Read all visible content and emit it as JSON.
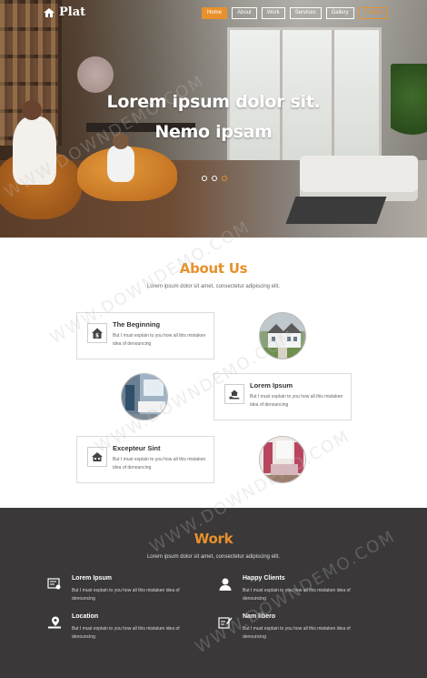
{
  "brand": {
    "name": "Plat"
  },
  "nav": {
    "items": [
      {
        "label": "Home",
        "state": "active"
      },
      {
        "label": "About",
        "state": ""
      },
      {
        "label": "Work",
        "state": ""
      },
      {
        "label": "Services",
        "state": ""
      },
      {
        "label": "Gallery",
        "state": ""
      },
      {
        "label": "Contact",
        "state": "contact"
      }
    ]
  },
  "hero": {
    "title_line1": "Lorem ipsum dolor sit.",
    "title_line2": "Nemo ipsam",
    "slider": {
      "count": 3,
      "active_index": 2
    }
  },
  "about": {
    "title": "About Us",
    "subtitle": "Lorem ipsum dolor sit amet, consectetur adipiscing elit.",
    "cards": [
      {
        "title": "The Beginning",
        "text": "But I must explain to you how all this mistaken idea of denouncing",
        "icon": "house-dollar-icon"
      },
      {
        "title": "Lorem Ipsum",
        "text": "But I must explain to you how all this mistaken idea of denouncing",
        "icon": "house-hand-icon"
      },
      {
        "title": "Excepteur Sint",
        "text": "But I must explain to you how all this mistaken idea of denouncing",
        "icon": "house-icon"
      }
    ],
    "photos": [
      "house-exterior-photo",
      "bathroom-photo",
      "bedroom-photo"
    ]
  },
  "work": {
    "title": "Work",
    "subtitle": "Lorem ipsum dolor sit amet, consectetur adipiscing elit.",
    "items": [
      {
        "title": "Lorem Ipsum",
        "text": "But I must explain to you how all this mistaken idea of denouncing",
        "icon": "certificate-icon"
      },
      {
        "title": "Happy Clients",
        "text": "But I must explain to you how all this mistaken idea of denouncing",
        "icon": "client-icon"
      },
      {
        "title": "Location",
        "text": "But I must explain to you how all this mistaken idea of denouncing",
        "icon": "location-icon"
      },
      {
        "title": "Nam libero",
        "text": "But I must explain to you how all this mistaken idea of denouncing",
        "icon": "edit-icon"
      }
    ]
  },
  "watermark": {
    "text": "WWW.DOWNDEMO.COM"
  },
  "colors": {
    "accent": "#e8912c",
    "dark": "#3a3838"
  }
}
